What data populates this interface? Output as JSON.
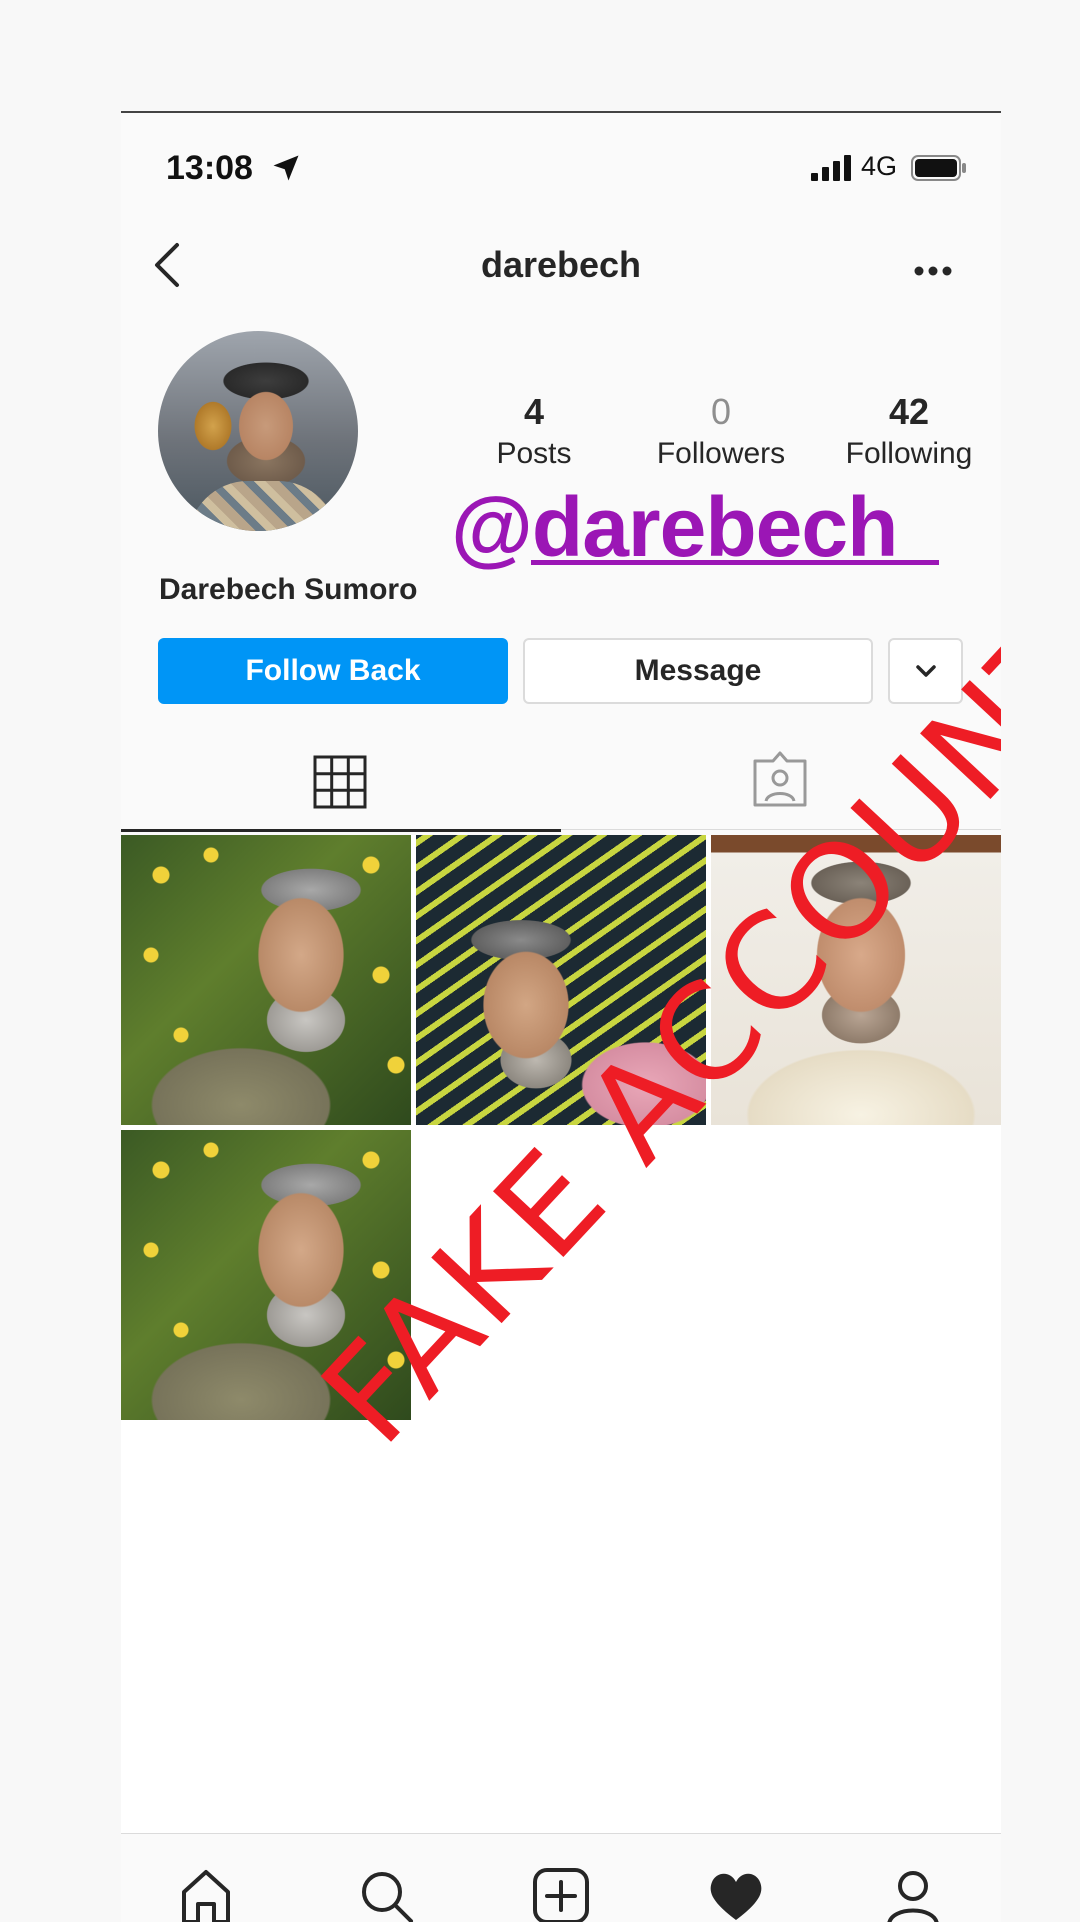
{
  "status_bar": {
    "time": "13:08",
    "network": "4G"
  },
  "header": {
    "username": "darebech"
  },
  "profile": {
    "full_name": "Darebech Sumoro",
    "stats": [
      {
        "value": "4",
        "label": "Posts"
      },
      {
        "value": "0",
        "label": "Followers"
      },
      {
        "value": "42",
        "label": "Following"
      }
    ]
  },
  "buttons": {
    "follow": "Follow Back",
    "message": "Message"
  },
  "overlay": {
    "handle": "@darebech",
    "stamp": "FAKE ACCOUNT"
  },
  "colors": {
    "follow_blue": "#0095f6",
    "handle_purple": "#9b16b5",
    "stamp_red": "#ee1d25"
  },
  "icons": [
    "location-arrow-icon",
    "signal-icon",
    "battery-icon",
    "back-chevron-icon",
    "more-options-icon",
    "chevron-down-icon",
    "grid-icon",
    "tagged-icon",
    "home-icon",
    "search-icon",
    "add-post-icon",
    "activity-heart-icon",
    "profile-icon"
  ]
}
